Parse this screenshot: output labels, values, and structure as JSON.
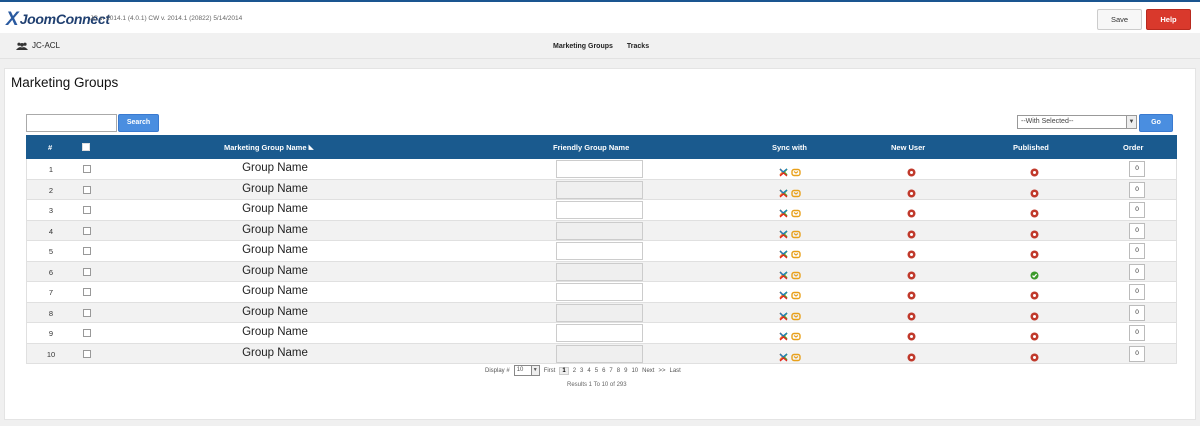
{
  "app": {
    "logo_text": "JoomConnect",
    "version": "JC v. 2014.1 (4.0.1) CW v. 2014.1 (20822) 5/14/2014",
    "save_label": "Save",
    "help_label": "Help"
  },
  "subnav": {
    "section": "JC-ACL",
    "links": [
      "Marketing Groups",
      "Tracks"
    ]
  },
  "page": {
    "title": "Marketing Groups",
    "search_label": "Search",
    "with_selected": "--With Selected--",
    "go_label": "Go"
  },
  "table": {
    "headers": {
      "num": "#",
      "name": "Marketing Group Name",
      "friendly": "Friendly Group Name",
      "sync": "Sync with",
      "new_user": "New User",
      "published": "Published",
      "order": "Order"
    },
    "rows": [
      {
        "num": "1",
        "name": "Group Name",
        "published": false,
        "order": "0"
      },
      {
        "num": "2",
        "name": "Group Name",
        "published": false,
        "order": "0"
      },
      {
        "num": "3",
        "name": "Group Name",
        "published": false,
        "order": "0"
      },
      {
        "num": "4",
        "name": "Group Name",
        "published": false,
        "order": "0"
      },
      {
        "num": "5",
        "name": "Group Name",
        "published": false,
        "order": "0"
      },
      {
        "num": "6",
        "name": "Group Name",
        "published": true,
        "order": "0"
      },
      {
        "num": "7",
        "name": "Group Name",
        "published": false,
        "order": "0"
      },
      {
        "num": "8",
        "name": "Group Name",
        "published": false,
        "order": "0"
      },
      {
        "num": "9",
        "name": "Group Name",
        "published": false,
        "order": "0"
      },
      {
        "num": "10",
        "name": "Group Name",
        "published": false,
        "order": "0"
      }
    ]
  },
  "pagination": {
    "display_label": "Display #",
    "display_value": "10",
    "first": "First",
    "pages": [
      "1",
      "2",
      "3",
      "4",
      "5",
      "6",
      "7",
      "8",
      "9",
      "10"
    ],
    "next": "Next",
    "next_arrows": ">>",
    "last": "Last",
    "results": "Results 1 To 10 of 293"
  },
  "colors": {
    "header_blue": "#1a5a8e",
    "button_blue": "#4a8ee0",
    "help_red": "#d9392c",
    "status_red": "#c0392b",
    "status_green": "#3a9a2a"
  }
}
